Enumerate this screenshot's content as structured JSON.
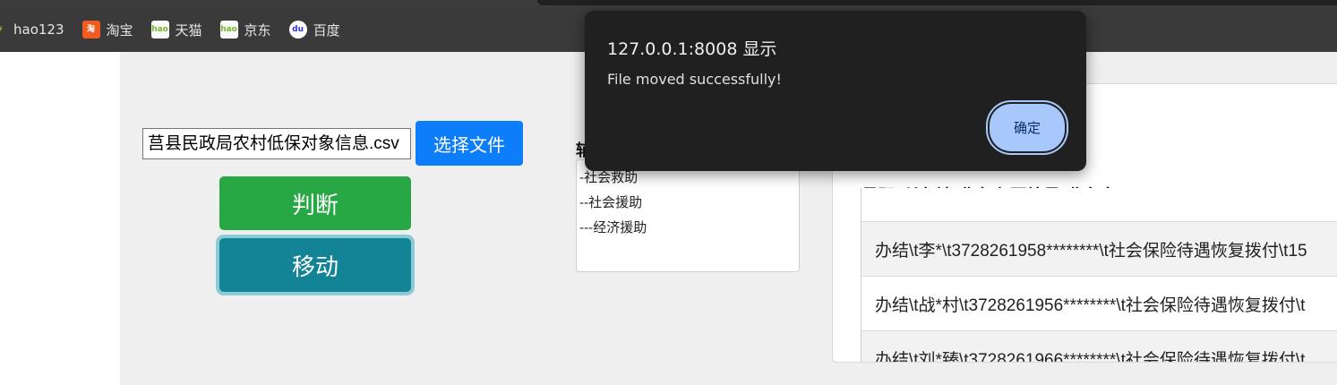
{
  "bookmarks": [
    {
      "label": "hao123",
      "icon": "hao123-icon",
      "glyph": "❦"
    },
    {
      "label": "淘宝",
      "icon": "taobao-icon",
      "glyph": "淘"
    },
    {
      "label": "天猫",
      "icon": "hao-tmall-icon",
      "glyph": "hao"
    },
    {
      "label": "京东",
      "icon": "hao-jd-icon",
      "glyph": "hao"
    },
    {
      "label": "百度",
      "icon": "baidu-paw-icon",
      "glyph": "du"
    }
  ],
  "form": {
    "file_name": "莒县民政局农村低保对象信息.csv",
    "choose_button": "选择文件",
    "judge_button": "判断",
    "move_button": "移动"
  },
  "tree": {
    "label": "辅",
    "items": [
      "-社会救助",
      "--社会援助",
      "---经济援助"
    ]
  },
  "table": {
    "header": "号码 所在地 业务主题编号 业务名",
    "rows": [
      "办结\\t李*\\t3728261958********\\t社会保险待遇恢复拨付\\t15",
      "办结\\t战*村\\t3728261956********\\t社会保险待遇恢复拨付\\t",
      "办结\\t刘*臻\\t3728261966********\\t社会保险待遇恢复拨付\\t"
    ]
  },
  "dialog": {
    "title": "127.0.0.1:8008 显示",
    "message": "File moved successfully!",
    "ok_button": "确定"
  },
  "colors": {
    "primary": "#0d7dfa",
    "success": "#28a745",
    "info": "#138496",
    "dialog_bg": "#202020",
    "dialog_button": "#a8c7fa"
  }
}
